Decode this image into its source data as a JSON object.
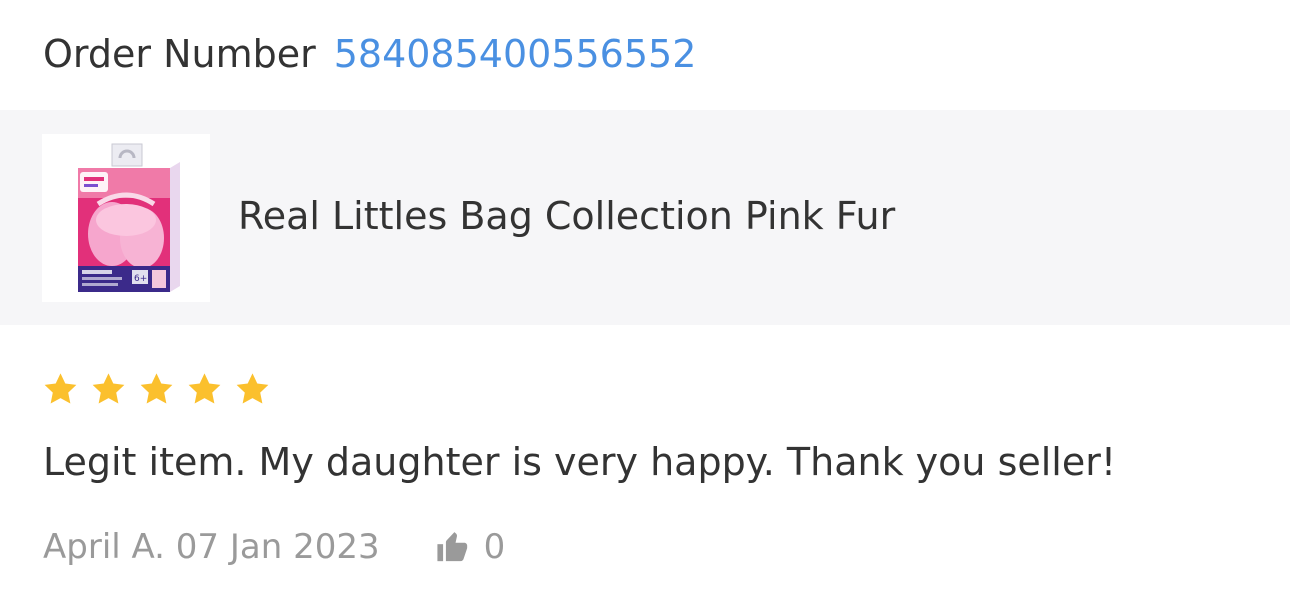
{
  "order": {
    "label": "Order Number",
    "number": "584085400556552"
  },
  "product": {
    "name": "Real Littles Bag Collection Pink Fur",
    "thumbnail_icon": "product-image"
  },
  "review": {
    "rating": 5,
    "rating_max": 5,
    "text": "Legit item. My daughter is very happy. Thank you seller!",
    "reviewer_and_date": "April A. 07 Jan 2023",
    "likes": "0"
  },
  "colors": {
    "link": "#4a90e2",
    "star": "#fbc02d",
    "band": "#f6f6f8",
    "muted": "#9a9a9a"
  }
}
